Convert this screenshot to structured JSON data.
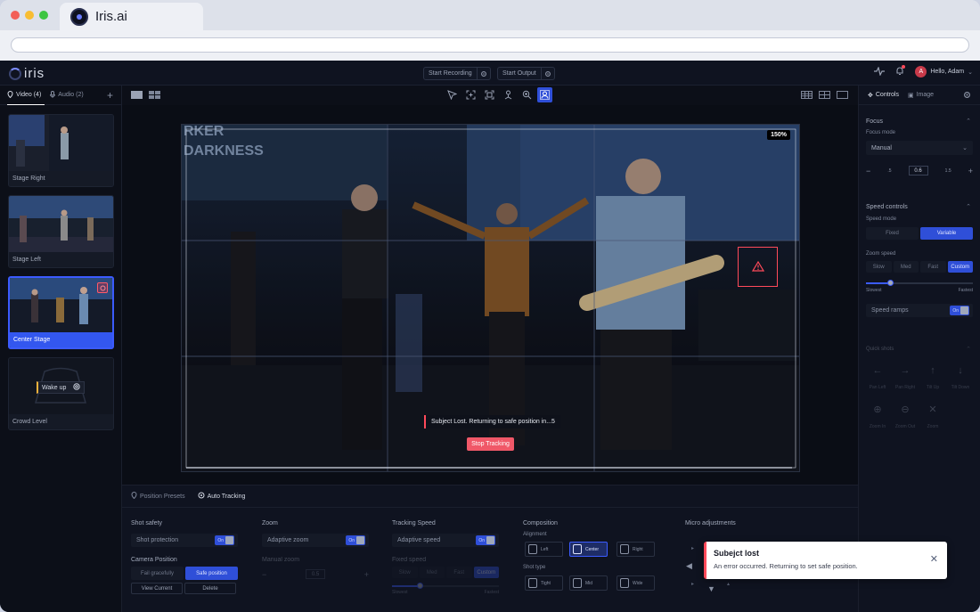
{
  "browser": {
    "tab_title": "Iris.ai"
  },
  "app": {
    "logo_text": "iris",
    "top": {
      "start_recording": "Start Recording",
      "start_output": "Start Output",
      "user_initial": "A",
      "hello": "Hello, Adam"
    },
    "left": {
      "tabs": [
        {
          "label": "Video (4)"
        },
        {
          "label": "Audio (2)"
        }
      ],
      "cameras": [
        {
          "label": "Stage Right"
        },
        {
          "label": "Stage Left"
        },
        {
          "label": "Center Stage"
        },
        {
          "label": "Crowd Level",
          "wake_label": "Wake up"
        }
      ]
    },
    "video": {
      "zoom": "150%",
      "lost_msg": "Subject Lost. Returning to safe position in...5",
      "stop_tracking": "Stop Tracking",
      "banner_line1": "RKER",
      "banner_line2": "DARKNESS"
    },
    "bottom": {
      "tabs": [
        {
          "label": "Position Presets"
        },
        {
          "label": "Auto Tracking"
        }
      ],
      "shot_safety": {
        "title": "Shot safety",
        "shot_protection": "Shot protection",
        "toggle": "On",
        "camera_position": "Camera Position",
        "fail_gracefully": "Fail gracefully",
        "safe_position": "Safe position",
        "view_current": "View Current",
        "delete": "Delete"
      },
      "zoom": {
        "title": "Zoom",
        "adaptive_zoom": "Adaptive zoom",
        "toggle": "On",
        "manual_zoom": "Manual zoom",
        "value": "0.5"
      },
      "tracking": {
        "title": "Tracking Speed",
        "adaptive_speed": "Adaptive speed",
        "toggle": "On",
        "fixed_speed": "Fixed speed",
        "options": [
          "Slow",
          "Med",
          "Fast",
          "Custom"
        ],
        "min": "Slowest",
        "max": "Fastest"
      },
      "composition": {
        "title": "Composition",
        "alignment": "Alignment",
        "align_opts": [
          "Left",
          "Center",
          "Right"
        ],
        "shot_type": "Shot type",
        "shot_opts": [
          "Tight",
          "Mid",
          "Wide"
        ]
      },
      "micro": {
        "title": "Micro adjustments"
      }
    },
    "right": {
      "tabs": [
        {
          "label": "Controls"
        },
        {
          "label": "Image"
        }
      ],
      "focus": {
        "title": "Focus",
        "mode_label": "Focus mode",
        "mode_value": "Manual",
        "step_small": ".5",
        "value": "0.6",
        "step_big": "1.5"
      },
      "speed": {
        "title": "Speed controls",
        "mode_label": "Speed mode",
        "fixed": "Fixed",
        "variable": "Variable",
        "zoom_speed": "Zoom speed",
        "options": [
          "Slow",
          "Med",
          "Fast",
          "Custom"
        ],
        "min": "Slowest",
        "max": "Fastest",
        "ramps": "Speed ramps",
        "toggle": "On"
      },
      "quick": {
        "title": "Quick shots",
        "items": [
          "Pan Left",
          "Pan Right",
          "Tilt Up",
          "Tilt Down",
          "Zoom In",
          "Zoom Out",
          "Zoom"
        ]
      }
    },
    "toast": {
      "title": "Subejct lost",
      "message": "An error occurred. Returning to set safe position."
    }
  },
  "colors": {
    "accent": "#2f4fd8",
    "danger": "#ff4a5a",
    "bg": "#0c0f18"
  }
}
